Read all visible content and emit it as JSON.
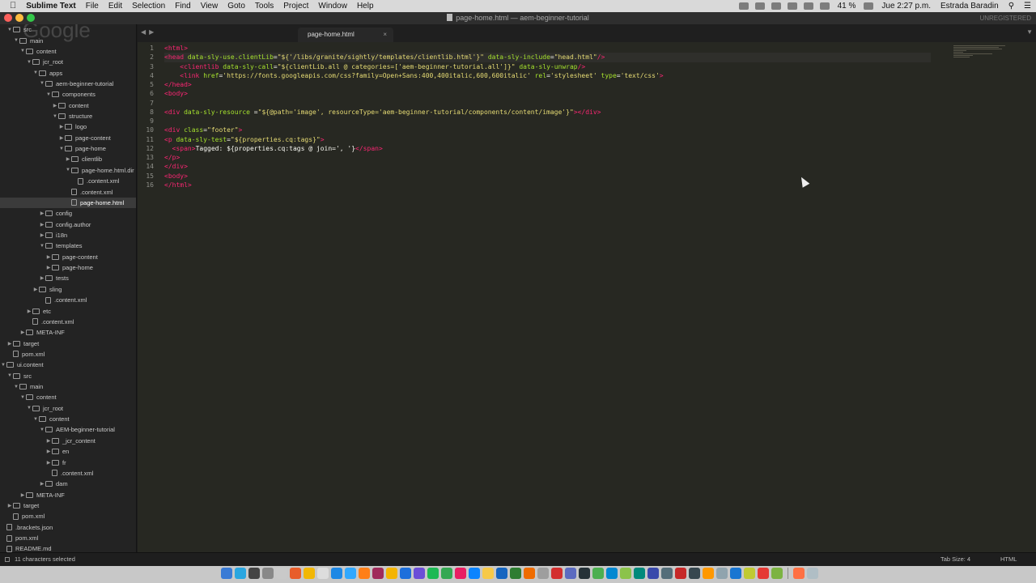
{
  "menubar": {
    "app_name": "Sublime Text",
    "items": [
      "File",
      "Edit",
      "Selection",
      "Find",
      "View",
      "Goto",
      "Tools",
      "Project",
      "Window",
      "Help"
    ],
    "battery": "41 %",
    "clock": "Jue 2:27 p.m.",
    "user": "Estrada Baradin"
  },
  "window": {
    "title": "page-home.html — aem-beginner-tutorial",
    "registration": "UNREGISTERED"
  },
  "watermark": "Google",
  "sidebar": {
    "items": [
      {
        "label": "src",
        "depth": 0,
        "twisty": "open",
        "kind": "folder"
      },
      {
        "label": "main",
        "depth": 1,
        "twisty": "open",
        "kind": "folder"
      },
      {
        "label": "content",
        "depth": 2,
        "twisty": "open",
        "kind": "folder"
      },
      {
        "label": "jcr_root",
        "depth": 3,
        "twisty": "open",
        "kind": "folder"
      },
      {
        "label": "apps",
        "depth": 4,
        "twisty": "open",
        "kind": "folder"
      },
      {
        "label": "aem-beginner-tutorial",
        "depth": 5,
        "twisty": "open",
        "kind": "folder"
      },
      {
        "label": "components",
        "depth": 6,
        "twisty": "open",
        "kind": "folder"
      },
      {
        "label": "content",
        "depth": 7,
        "twisty": "closed",
        "kind": "folder"
      },
      {
        "label": "structure",
        "depth": 7,
        "twisty": "open",
        "kind": "folder"
      },
      {
        "label": "logo",
        "depth": 8,
        "twisty": "closed",
        "kind": "folder"
      },
      {
        "label": "page-content",
        "depth": 8,
        "twisty": "closed",
        "kind": "folder"
      },
      {
        "label": "page-home",
        "depth": 8,
        "twisty": "open",
        "kind": "folder"
      },
      {
        "label": "clientlib",
        "depth": 9,
        "twisty": "closed",
        "kind": "folder"
      },
      {
        "label": "page-home.html.dir",
        "depth": 9,
        "twisty": "open",
        "kind": "folder"
      },
      {
        "label": ".content.xml",
        "depth": 10,
        "twisty": "",
        "kind": "file"
      },
      {
        "label": ".content.xml",
        "depth": 9,
        "twisty": "",
        "kind": "file"
      },
      {
        "label": "page-home.html",
        "depth": 9,
        "twisty": "",
        "kind": "file",
        "selected": true
      },
      {
        "label": "config",
        "depth": 5,
        "twisty": "closed",
        "kind": "folder"
      },
      {
        "label": "config.author",
        "depth": 5,
        "twisty": "closed",
        "kind": "folder"
      },
      {
        "label": "i18n",
        "depth": 5,
        "twisty": "closed",
        "kind": "folder"
      },
      {
        "label": "templates",
        "depth": 5,
        "twisty": "open",
        "kind": "folder"
      },
      {
        "label": "page-content",
        "depth": 6,
        "twisty": "closed",
        "kind": "folder"
      },
      {
        "label": "page-home",
        "depth": 6,
        "twisty": "closed",
        "kind": "folder"
      },
      {
        "label": "tests",
        "depth": 5,
        "twisty": "closed",
        "kind": "folder"
      },
      {
        "label": "sling",
        "depth": 4,
        "twisty": "closed",
        "kind": "folder"
      },
      {
        "label": ".content.xml",
        "depth": 5,
        "twisty": "",
        "kind": "file"
      },
      {
        "label": "etc",
        "depth": 3,
        "twisty": "closed",
        "kind": "folder"
      },
      {
        "label": ".content.xml",
        "depth": 3,
        "twisty": "",
        "kind": "file"
      },
      {
        "label": "META-INF",
        "depth": 2,
        "twisty": "closed",
        "kind": "folder"
      },
      {
        "label": "target",
        "depth": 0,
        "twisty": "closed",
        "kind": "folder"
      },
      {
        "label": "pom.xml",
        "depth": 0,
        "twisty": "",
        "kind": "file"
      },
      {
        "label": "ui.content",
        "depth": -1,
        "twisty": "open",
        "kind": "folder"
      },
      {
        "label": "src",
        "depth": 0,
        "twisty": "open",
        "kind": "folder"
      },
      {
        "label": "main",
        "depth": 1,
        "twisty": "open",
        "kind": "folder"
      },
      {
        "label": "content",
        "depth": 2,
        "twisty": "open",
        "kind": "folder"
      },
      {
        "label": "jcr_root",
        "depth": 3,
        "twisty": "open",
        "kind": "folder"
      },
      {
        "label": "content",
        "depth": 4,
        "twisty": "open",
        "kind": "folder"
      },
      {
        "label": "AEM-beginner-tutorial",
        "depth": 5,
        "twisty": "open",
        "kind": "folder"
      },
      {
        "label": "_jcr_content",
        "depth": 6,
        "twisty": "closed",
        "kind": "folder"
      },
      {
        "label": "en",
        "depth": 6,
        "twisty": "closed",
        "kind": "folder"
      },
      {
        "label": "fr",
        "depth": 6,
        "twisty": "closed",
        "kind": "folder"
      },
      {
        "label": ".content.xml",
        "depth": 6,
        "twisty": "",
        "kind": "file"
      },
      {
        "label": "dam",
        "depth": 5,
        "twisty": "closed",
        "kind": "folder"
      },
      {
        "label": "META-INF",
        "depth": 2,
        "twisty": "closed",
        "kind": "folder"
      },
      {
        "label": "target",
        "depth": 0,
        "twisty": "closed",
        "kind": "folder"
      },
      {
        "label": "pom.xml",
        "depth": 0,
        "twisty": "",
        "kind": "file"
      },
      {
        "label": ".brackets.json",
        "depth": -1,
        "twisty": "",
        "kind": "file"
      },
      {
        "label": "pom.xml",
        "depth": -1,
        "twisty": "",
        "kind": "file"
      },
      {
        "label": "README.md",
        "depth": -1,
        "twisty": "",
        "kind": "file"
      }
    ]
  },
  "tab": {
    "label": "page-home.html",
    "close": "×"
  },
  "editor": {
    "current_line": 2,
    "lines": [
      [
        [
          "t",
          "<html>"
        ]
      ],
      [
        [
          "t",
          "<head"
        ],
        [
          "x",
          " "
        ],
        [
          "a",
          "data-sly-use.clientLib"
        ],
        [
          "x",
          "="
        ],
        [
          "s",
          "\"${'/libs/granite/sightly/templates/clientlib.html'}\""
        ],
        [
          "x",
          " "
        ],
        [
          "a",
          "data-sly-include"
        ],
        [
          "x",
          "="
        ],
        [
          "s",
          "\"head.html\""
        ],
        [
          "t",
          "/>"
        ]
      ],
      [
        [
          "x",
          "    "
        ],
        [
          "t",
          "<clientlib"
        ],
        [
          "x",
          " "
        ],
        [
          "a",
          "data-sly-call"
        ],
        [
          "x",
          "="
        ],
        [
          "s",
          "\"${clientLib.all @ categories=['aem-beginner-tutorial.all']}\""
        ],
        [
          "x",
          " "
        ],
        [
          "a",
          "data-sly-unwrap"
        ],
        [
          "t",
          "/>"
        ]
      ],
      [
        [
          "x",
          "    "
        ],
        [
          "t",
          "<link"
        ],
        [
          "x",
          " "
        ],
        [
          "a",
          "href"
        ],
        [
          "x",
          "="
        ],
        [
          "s",
          "'https://fonts.googleapis.com/css?family=Open+Sans:400,400italic,600,600italic'"
        ],
        [
          "x",
          " "
        ],
        [
          "a",
          "rel"
        ],
        [
          "x",
          "="
        ],
        [
          "s",
          "'stylesheet'"
        ],
        [
          "x",
          " "
        ],
        [
          "a",
          "type"
        ],
        [
          "x",
          "="
        ],
        [
          "s",
          "'text/css'"
        ],
        [
          "t",
          ">"
        ]
      ],
      [
        [
          "t",
          "</head>"
        ]
      ],
      [
        [
          "t",
          "<body>"
        ]
      ],
      [],
      [
        [
          "t",
          "<div"
        ],
        [
          "x",
          " "
        ],
        [
          "a",
          "data-sly-resource"
        ],
        [
          "x",
          " ="
        ],
        [
          "s",
          "\"${@path='image', resourceType='aem-beginner-tutorial/components/content/image'}\""
        ],
        [
          "t",
          "></div>"
        ]
      ],
      [],
      [
        [
          "t",
          "<div"
        ],
        [
          "x",
          " "
        ],
        [
          "a",
          "class"
        ],
        [
          "x",
          "="
        ],
        [
          "s",
          "\"footer\""
        ],
        [
          "t",
          ">"
        ]
      ],
      [
        [
          "t",
          "<p"
        ],
        [
          "x",
          " "
        ],
        [
          "a",
          "data-sly-test"
        ],
        [
          "x",
          "="
        ],
        [
          "s",
          "\"${properties.cq:tags}\""
        ],
        [
          "t",
          ">"
        ]
      ],
      [
        [
          "x",
          "  "
        ],
        [
          "t",
          "<span"
        ],
        [
          "t",
          ">"
        ],
        [
          "x",
          "Tagged: ${properties.cq:tags @ join=', '}"
        ],
        [
          "t",
          "</span>"
        ]
      ],
      [
        [
          "t",
          "</p>"
        ]
      ],
      [
        [
          "t",
          "</div>"
        ]
      ],
      [
        [
          "t",
          "<body>"
        ]
      ],
      [
        [
          "t",
          "</html>"
        ]
      ]
    ]
  },
  "statusbar": {
    "selection": "11 characters selected",
    "tab_size": "Tab Size: 4",
    "syntax": "HTML"
  },
  "colors": {
    "tag": "#f92672",
    "attr": "#a6e22e",
    "string": "#e6db74",
    "text": "#f8f8f2",
    "editor_bg": "#272822"
  }
}
